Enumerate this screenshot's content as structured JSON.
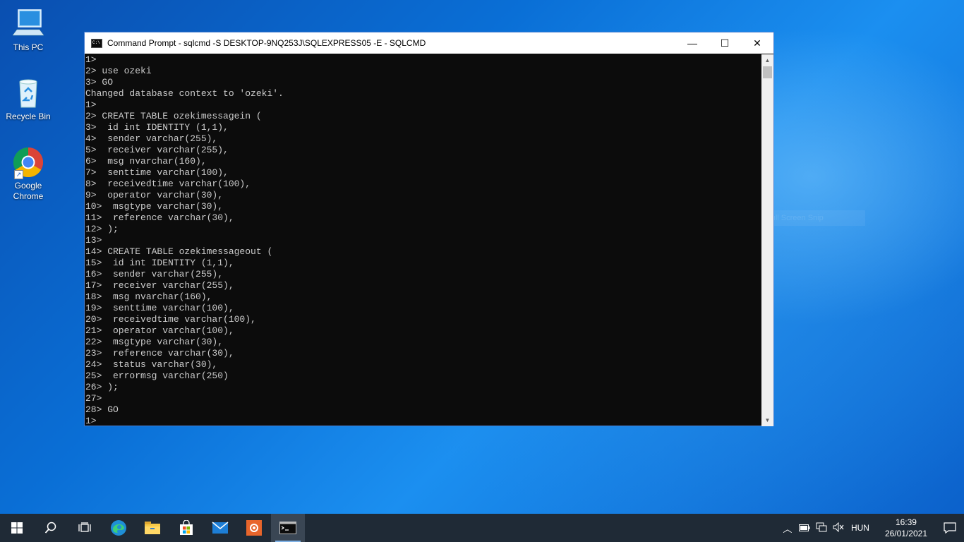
{
  "desktop": {
    "icons": [
      {
        "label": "This PC",
        "icon": "computer-icon"
      },
      {
        "label": "Recycle Bin",
        "icon": "recycle-bin-icon"
      },
      {
        "label": "Google Chrome",
        "icon": "chrome-icon"
      }
    ],
    "ghost_text": "Full Screen Snip"
  },
  "window": {
    "title": "Command Prompt - sqlcmd  -S DESKTOP-9NQ253J\\SQLEXPRESS05 -E - SQLCMD",
    "controls": {
      "minimize": "—",
      "maximize": "☐",
      "close": "✕"
    },
    "lines": [
      "1>",
      "2> use ozeki",
      "3> GO",
      "Changed database context to 'ozeki'.",
      "1>",
      "2> CREATE TABLE ozekimessagein (",
      "3>  id int IDENTITY (1,1),",
      "4>  sender varchar(255),",
      "5>  receiver varchar(255),",
      "6>  msg nvarchar(160),",
      "7>  senttime varchar(100),",
      "8>  receivedtime varchar(100),",
      "9>  operator varchar(30),",
      "10>  msgtype varchar(30),",
      "11>  reference varchar(30),",
      "12> );",
      "13>",
      "14> CREATE TABLE ozekimessageout (",
      "15>  id int IDENTITY (1,1),",
      "16>  sender varchar(255),",
      "17>  receiver varchar(255),",
      "18>  msg nvarchar(160),",
      "19>  senttime varchar(100),",
      "20>  receivedtime varchar(100),",
      "21>  operator varchar(100),",
      "22>  msgtype varchar(30),",
      "23>  reference varchar(30),",
      "24>  status varchar(30),",
      "25>  errormsg varchar(250)",
      "26> );",
      "27>",
      "28> GO",
      "1>"
    ]
  },
  "taskbar": {
    "apps": [
      "start-icon",
      "search-icon",
      "task-view-icon",
      "edge-icon",
      "file-explorer-icon",
      "store-icon",
      "mail-icon",
      "ozeki-icon",
      "cmd-icon"
    ],
    "language": "HUN",
    "time": "16:39",
    "date": "26/01/2021"
  },
  "colors": {
    "terminal_bg": "#0c0c0c",
    "terminal_fg": "#cccccc",
    "taskbar_bg": "#1f2a36"
  }
}
